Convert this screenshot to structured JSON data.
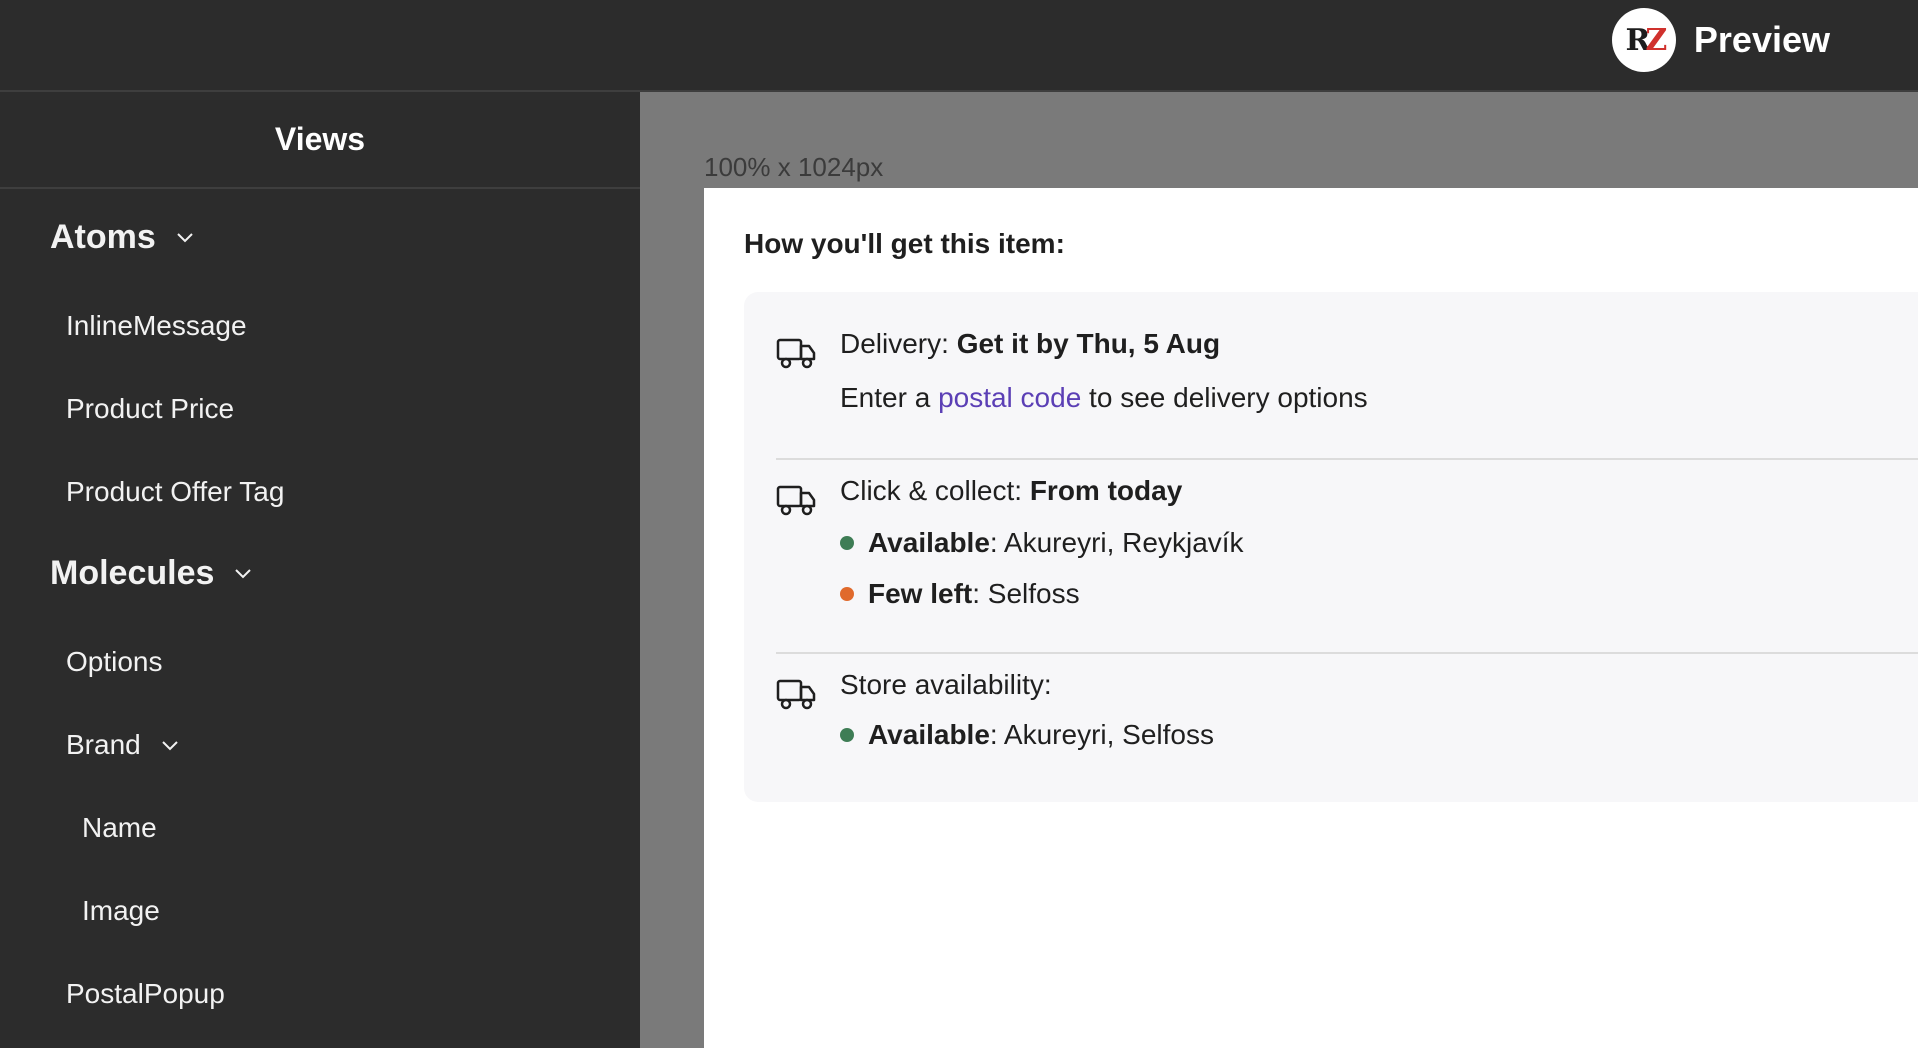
{
  "header": {
    "brand_title": "Preview",
    "logo_r": "R",
    "logo_z": "Z"
  },
  "sidebar": {
    "title": "Views",
    "items": [
      {
        "label": "Atoms"
      },
      {
        "label": "InlineMessage"
      },
      {
        "label": "Product Price"
      },
      {
        "label": "Product Offer Tag"
      },
      {
        "label": "Molecules"
      },
      {
        "label": "Options"
      },
      {
        "label": "Brand"
      },
      {
        "label": "Name"
      },
      {
        "label": "Image"
      },
      {
        "label": "PostalPopup"
      }
    ]
  },
  "canvas": {
    "dimension_label": "100% x 1024px",
    "title": "How you'll get this item:",
    "delivery": {
      "label": "Delivery: ",
      "value": "Get it by Thu, 5 Aug",
      "sub_prefix": "Enter a ",
      "sub_link": "postal code",
      "sub_suffix": " to see delivery options"
    },
    "collect": {
      "label": "Click & collect: ",
      "value": "From today",
      "available_label": "Available",
      "available_value": ": Akureyri, Reykjavík",
      "few_label": "Few left",
      "few_value": ": Selfoss"
    },
    "store": {
      "label": "Store availability:",
      "available_label": "Available",
      "available_value": ": Akureyri, Selfoss"
    }
  },
  "colors": {
    "background": "#2c2c2c",
    "canvas": "#7a7a7a",
    "link": "#5b3fb5",
    "available": "#3e7d55",
    "few_left": "#e06a2c"
  },
  "icons": [
    "chevron-down-icon",
    "truck-icon"
  ]
}
